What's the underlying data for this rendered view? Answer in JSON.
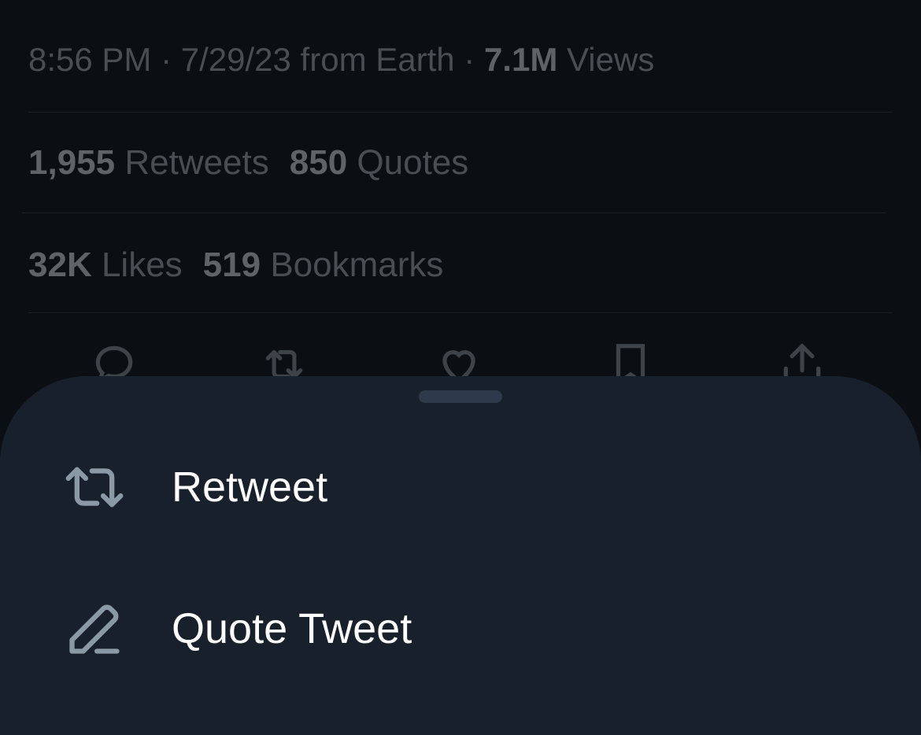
{
  "tweet_meta": {
    "time": "8:56 PM",
    "separator": " · ",
    "date": "7/29/23",
    "source": " from Earth",
    "views_count": "7.1M",
    "views_label": " Views"
  },
  "stats": {
    "retweets_count": "1,955",
    "retweets_label": " Retweets",
    "quotes_count": "850",
    "quotes_label": " Quotes",
    "likes_count": "32K",
    "likes_label": " Likes",
    "bookmarks_count": "519",
    "bookmarks_label": " Bookmarks"
  },
  "actions": [
    {
      "icon": "reply-icon"
    },
    {
      "icon": "retweet-icon"
    },
    {
      "icon": "heart-icon"
    },
    {
      "icon": "bookmark-icon"
    },
    {
      "icon": "share-icon"
    }
  ],
  "sheet": {
    "items": [
      {
        "label": "Retweet",
        "icon": "retweet-icon"
      },
      {
        "label": "Quote Tweet",
        "icon": "pencil-icon"
      }
    ]
  },
  "colors": {
    "background": "#0b0e12",
    "sheet": "#17202b",
    "grabber": "#2d3a4b",
    "sheet_text": "#ffffff",
    "sheet_icon": "#8b98a5",
    "dimmed_text": "#4a4e54"
  }
}
